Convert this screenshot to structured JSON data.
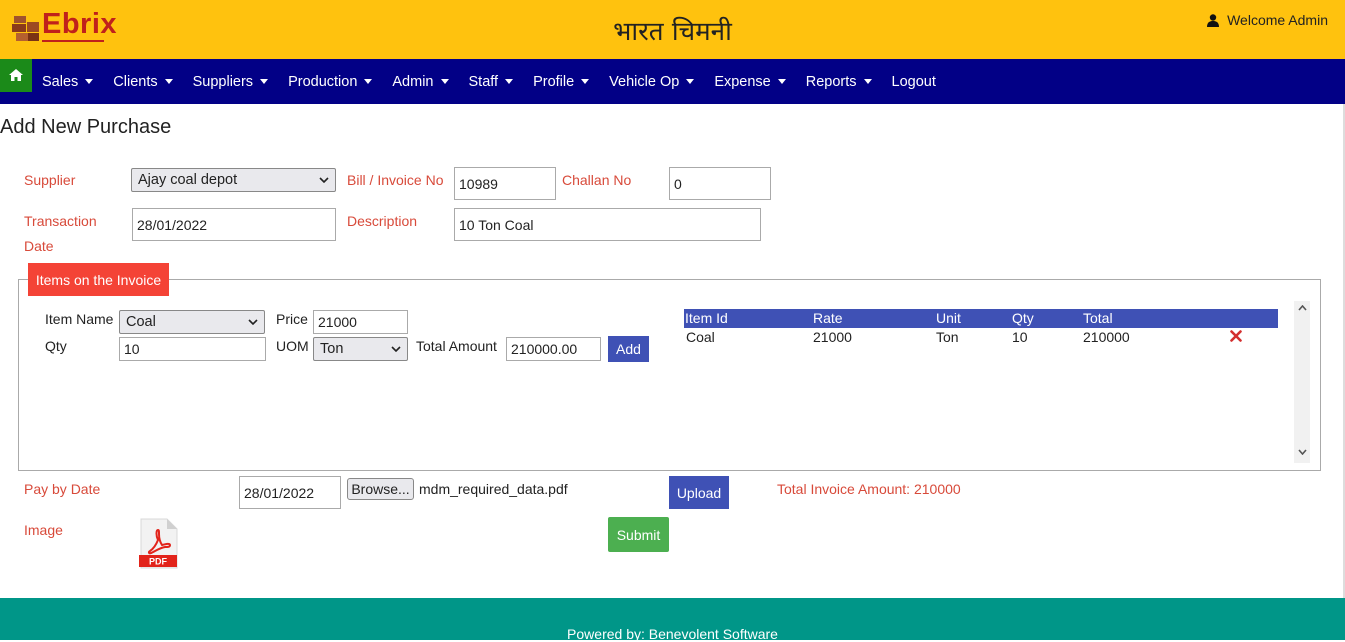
{
  "header": {
    "logo_text": "Ebrix",
    "title": "भारत चिमनी",
    "welcome": "Welcome Admin",
    "user_icon": "user-icon"
  },
  "nav": {
    "home_icon": "home-icon",
    "items": [
      {
        "label": "Sales",
        "dropdown": true
      },
      {
        "label": "Clients",
        "dropdown": true
      },
      {
        "label": "Suppliers",
        "dropdown": true
      },
      {
        "label": "Production",
        "dropdown": true
      },
      {
        "label": "Admin",
        "dropdown": true
      },
      {
        "label": "Staff",
        "dropdown": true
      },
      {
        "label": "Profile",
        "dropdown": true
      },
      {
        "label": "Vehicle Op",
        "dropdown": true
      },
      {
        "label": "Expense",
        "dropdown": true
      },
      {
        "label": "Reports",
        "dropdown": true
      },
      {
        "label": "Logout",
        "dropdown": false
      }
    ]
  },
  "page": {
    "title": "Add New Purchase"
  },
  "form": {
    "supplier_label": "Supplier",
    "supplier_value": "Ajay coal depot",
    "bill_label": "Bill / Invoice No",
    "bill_value": "10989",
    "challan_label": "Challan No",
    "challan_value": "0",
    "txn_label_line1": "Transaction",
    "txn_label_line2": "Date",
    "txn_value": "28/01/2022",
    "desc_label": "Description",
    "desc_value": "10 Ton Coal",
    "pay_label": "Pay by Date",
    "pay_value": "28/01/2022",
    "browse_label": "Browse...",
    "file_name": "mdm_required_data.pdf",
    "upload_label": "Upload",
    "total_invoice": "Total Invoice Amount: 210000",
    "image_label": "Image",
    "pdf_icon_text": "PDF",
    "submit_label": "Submit"
  },
  "items": {
    "legend": "Items on the Invoice",
    "item_name_label": "Item Name",
    "item_name_value": "Coal",
    "price_label": "Price",
    "price_value": "21000",
    "qty_label": "Qty",
    "qty_value": "10",
    "uom_label": "UOM",
    "uom_value": "Ton",
    "total_label": "Total Amount",
    "total_value": "210000.00",
    "add_label": "Add",
    "table": {
      "headers": [
        "Item Id",
        "Rate",
        "Unit",
        "Qty",
        "Total"
      ],
      "rows": [
        [
          "Coal",
          "21000",
          "Ton",
          "10",
          "210000"
        ]
      ]
    }
  },
  "footer": {
    "text": "Powered by: Benevolent Software"
  },
  "colors": {
    "header_bg": "#ffc20e",
    "nav_bg": "#020086",
    "label_red": "#d84a3a",
    "accent_blue": "#3f51b5",
    "submit_green": "#4caf50",
    "footer_bg": "#009688"
  }
}
